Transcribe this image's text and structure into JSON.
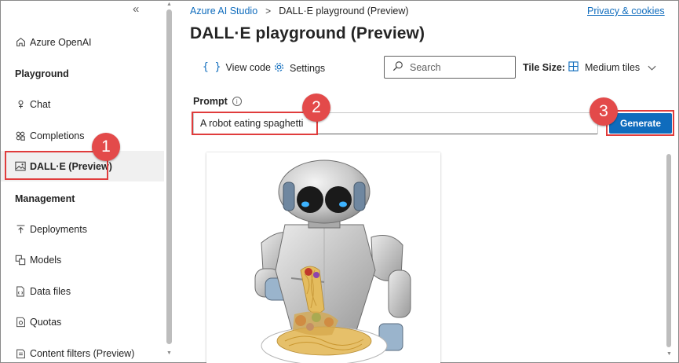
{
  "sidebar": {
    "collapse_glyph": "«",
    "home_label": "Azure OpenAI",
    "playground_heading": "Playground",
    "items_playground": [
      {
        "label": "Chat",
        "icon": "chat-icon"
      },
      {
        "label": "Completions",
        "icon": "completions-icon"
      },
      {
        "label": "DALL·E (Preview)",
        "icon": "image-icon",
        "active": true
      }
    ],
    "management_heading": "Management",
    "items_management": [
      {
        "label": "Deployments",
        "icon": "deployments-icon"
      },
      {
        "label": "Models",
        "icon": "models-icon"
      },
      {
        "label": "Data files",
        "icon": "data-files-icon"
      },
      {
        "label": "Quotas",
        "icon": "quotas-icon"
      },
      {
        "label": "Content filters (Preview)",
        "icon": "shield-icon"
      }
    ]
  },
  "header": {
    "breadcrumb_root": "Azure AI Studio",
    "breadcrumb_sep": ">",
    "breadcrumb_current": "DALL·E playground (Preview)",
    "privacy_link": "Privacy & cookies",
    "page_title": "DALL·E playground (Preview)"
  },
  "toolbar": {
    "view_code_icon": "{ }",
    "view_code_label": "View code",
    "settings_label": "Settings",
    "search_placeholder": "Search",
    "tile_size_label": "Tile Size:",
    "tile_size_value": "Medium tiles"
  },
  "prompt": {
    "label": "Prompt",
    "info_glyph": "i",
    "value": "A robot eating spaghetti"
  },
  "generate_label": "Generate",
  "annotations": {
    "badge_1": "1",
    "badge_2": "2",
    "badge_3": "3",
    "color": "#e03c3c"
  },
  "colors": {
    "accent": "#0f6cbd",
    "annotation_red": "#e34a4a"
  }
}
